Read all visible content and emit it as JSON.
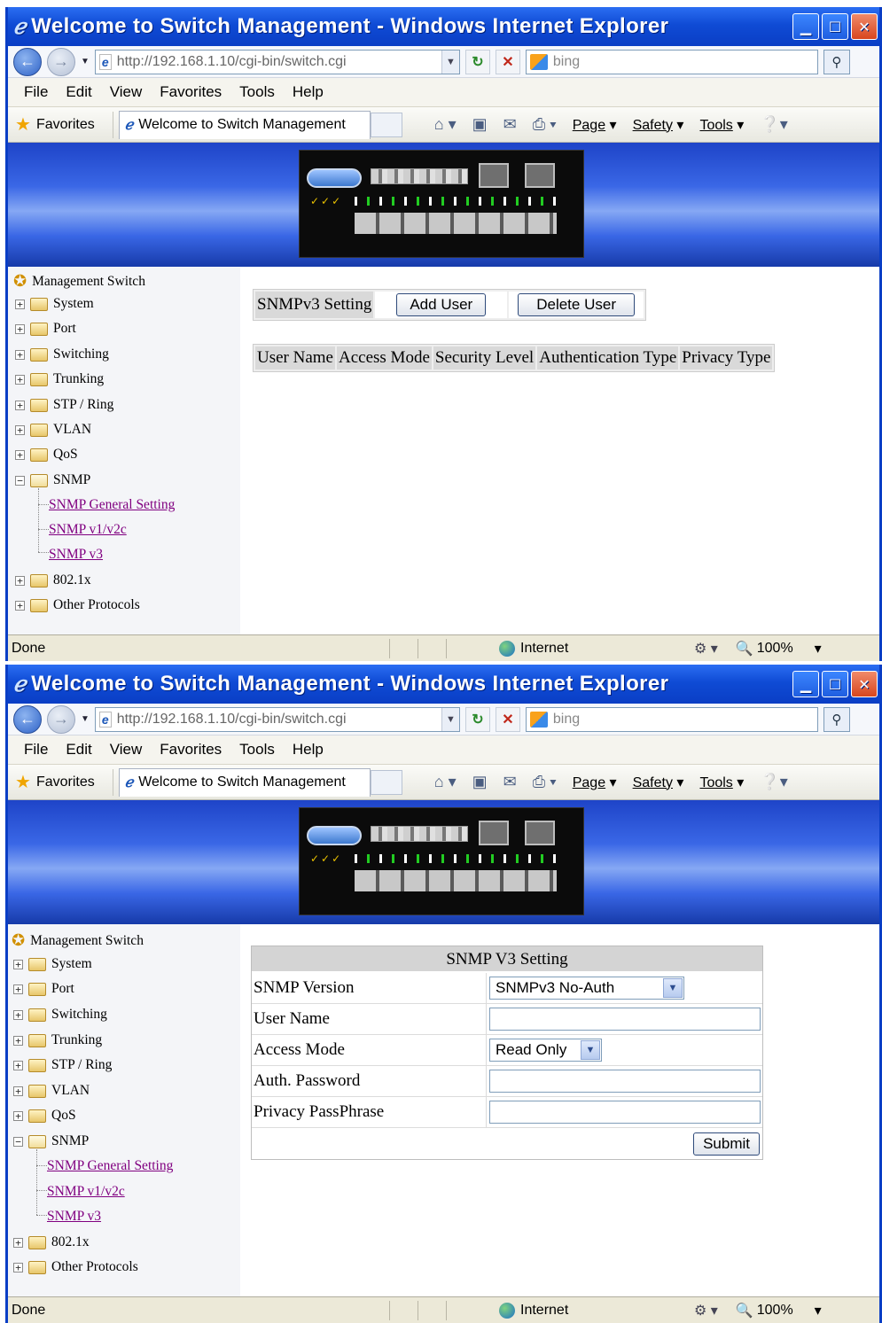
{
  "window": {
    "title": "Welcome to Switch Management - Windows Internet Explorer",
    "url_host": "http://192.168.1.10",
    "url_path": "/cgi-bin/switch.cgi",
    "search_placeholder": "bing",
    "menu": [
      "File",
      "Edit",
      "View",
      "Favorites",
      "Tools",
      "Help"
    ],
    "favorites_label": "Favorites",
    "tab_title": "Welcome to Switch Management",
    "commands": {
      "page": "Page",
      "safety": "Safety",
      "tools": "Tools"
    },
    "status": {
      "done": "Done",
      "zone": "Internet",
      "zoom": "100%"
    }
  },
  "sidebar": {
    "root": "Management Switch",
    "items": [
      "System",
      "Port",
      "Switching",
      "Trunking",
      "STP / Ring",
      "VLAN",
      "QoS",
      "SNMP"
    ],
    "snmp_children": [
      "SNMP General Setting",
      "SNMP v1/v2c",
      "SNMP v3"
    ],
    "after": [
      "802.1x",
      "Other Protocols"
    ]
  },
  "screen1": {
    "section_label": "SNMPv3 Setting",
    "add_user": "Add User",
    "delete_user": "Delete User",
    "columns": [
      "User Name",
      "Access Mode",
      "Security Level",
      "Authentication Type",
      "Privacy Type"
    ]
  },
  "screen2": {
    "heading": "SNMP V3 Setting",
    "fields": {
      "version_label": "SNMP Version",
      "version_value": "SNMPv3 No-Auth",
      "username_label": "User Name",
      "access_label": "Access Mode",
      "access_value": "Read Only",
      "auth_label": "Auth. Password",
      "privacy_label": "Privacy PassPhrase"
    },
    "submit": "Submit"
  }
}
